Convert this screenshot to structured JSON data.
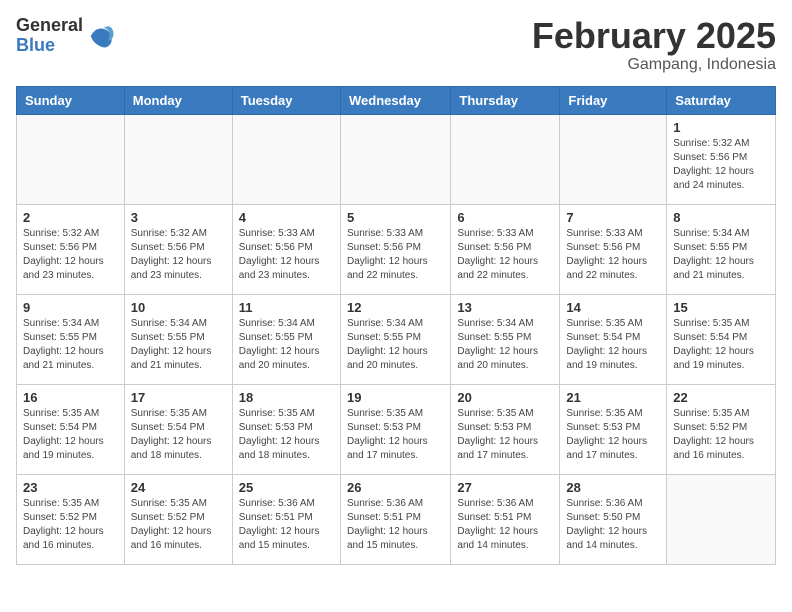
{
  "logo": {
    "general": "General",
    "blue": "Blue"
  },
  "header": {
    "title": "February 2025",
    "location": "Gampang, Indonesia"
  },
  "weekdays": [
    "Sunday",
    "Monday",
    "Tuesday",
    "Wednesday",
    "Thursday",
    "Friday",
    "Saturday"
  ],
  "weeks": [
    [
      {
        "day": "",
        "info": ""
      },
      {
        "day": "",
        "info": ""
      },
      {
        "day": "",
        "info": ""
      },
      {
        "day": "",
        "info": ""
      },
      {
        "day": "",
        "info": ""
      },
      {
        "day": "",
        "info": ""
      },
      {
        "day": "1",
        "info": "Sunrise: 5:32 AM\nSunset: 5:56 PM\nDaylight: 12 hours\nand 24 minutes."
      }
    ],
    [
      {
        "day": "2",
        "info": "Sunrise: 5:32 AM\nSunset: 5:56 PM\nDaylight: 12 hours\nand 23 minutes."
      },
      {
        "day": "3",
        "info": "Sunrise: 5:32 AM\nSunset: 5:56 PM\nDaylight: 12 hours\nand 23 minutes."
      },
      {
        "day": "4",
        "info": "Sunrise: 5:33 AM\nSunset: 5:56 PM\nDaylight: 12 hours\nand 23 minutes."
      },
      {
        "day": "5",
        "info": "Sunrise: 5:33 AM\nSunset: 5:56 PM\nDaylight: 12 hours\nand 22 minutes."
      },
      {
        "day": "6",
        "info": "Sunrise: 5:33 AM\nSunset: 5:56 PM\nDaylight: 12 hours\nand 22 minutes."
      },
      {
        "day": "7",
        "info": "Sunrise: 5:33 AM\nSunset: 5:56 PM\nDaylight: 12 hours\nand 22 minutes."
      },
      {
        "day": "8",
        "info": "Sunrise: 5:34 AM\nSunset: 5:55 PM\nDaylight: 12 hours\nand 21 minutes."
      }
    ],
    [
      {
        "day": "9",
        "info": "Sunrise: 5:34 AM\nSunset: 5:55 PM\nDaylight: 12 hours\nand 21 minutes."
      },
      {
        "day": "10",
        "info": "Sunrise: 5:34 AM\nSunset: 5:55 PM\nDaylight: 12 hours\nand 21 minutes."
      },
      {
        "day": "11",
        "info": "Sunrise: 5:34 AM\nSunset: 5:55 PM\nDaylight: 12 hours\nand 20 minutes."
      },
      {
        "day": "12",
        "info": "Sunrise: 5:34 AM\nSunset: 5:55 PM\nDaylight: 12 hours\nand 20 minutes."
      },
      {
        "day": "13",
        "info": "Sunrise: 5:34 AM\nSunset: 5:55 PM\nDaylight: 12 hours\nand 20 minutes."
      },
      {
        "day": "14",
        "info": "Sunrise: 5:35 AM\nSunset: 5:54 PM\nDaylight: 12 hours\nand 19 minutes."
      },
      {
        "day": "15",
        "info": "Sunrise: 5:35 AM\nSunset: 5:54 PM\nDaylight: 12 hours\nand 19 minutes."
      }
    ],
    [
      {
        "day": "16",
        "info": "Sunrise: 5:35 AM\nSunset: 5:54 PM\nDaylight: 12 hours\nand 19 minutes."
      },
      {
        "day": "17",
        "info": "Sunrise: 5:35 AM\nSunset: 5:54 PM\nDaylight: 12 hours\nand 18 minutes."
      },
      {
        "day": "18",
        "info": "Sunrise: 5:35 AM\nSunset: 5:53 PM\nDaylight: 12 hours\nand 18 minutes."
      },
      {
        "day": "19",
        "info": "Sunrise: 5:35 AM\nSunset: 5:53 PM\nDaylight: 12 hours\nand 17 minutes."
      },
      {
        "day": "20",
        "info": "Sunrise: 5:35 AM\nSunset: 5:53 PM\nDaylight: 12 hours\nand 17 minutes."
      },
      {
        "day": "21",
        "info": "Sunrise: 5:35 AM\nSunset: 5:53 PM\nDaylight: 12 hours\nand 17 minutes."
      },
      {
        "day": "22",
        "info": "Sunrise: 5:35 AM\nSunset: 5:52 PM\nDaylight: 12 hours\nand 16 minutes."
      }
    ],
    [
      {
        "day": "23",
        "info": "Sunrise: 5:35 AM\nSunset: 5:52 PM\nDaylight: 12 hours\nand 16 minutes."
      },
      {
        "day": "24",
        "info": "Sunrise: 5:35 AM\nSunset: 5:52 PM\nDaylight: 12 hours\nand 16 minutes."
      },
      {
        "day": "25",
        "info": "Sunrise: 5:36 AM\nSunset: 5:51 PM\nDaylight: 12 hours\nand 15 minutes."
      },
      {
        "day": "26",
        "info": "Sunrise: 5:36 AM\nSunset: 5:51 PM\nDaylight: 12 hours\nand 15 minutes."
      },
      {
        "day": "27",
        "info": "Sunrise: 5:36 AM\nSunset: 5:51 PM\nDaylight: 12 hours\nand 14 minutes."
      },
      {
        "day": "28",
        "info": "Sunrise: 5:36 AM\nSunset: 5:50 PM\nDaylight: 12 hours\nand 14 minutes."
      },
      {
        "day": "",
        "info": ""
      }
    ]
  ]
}
